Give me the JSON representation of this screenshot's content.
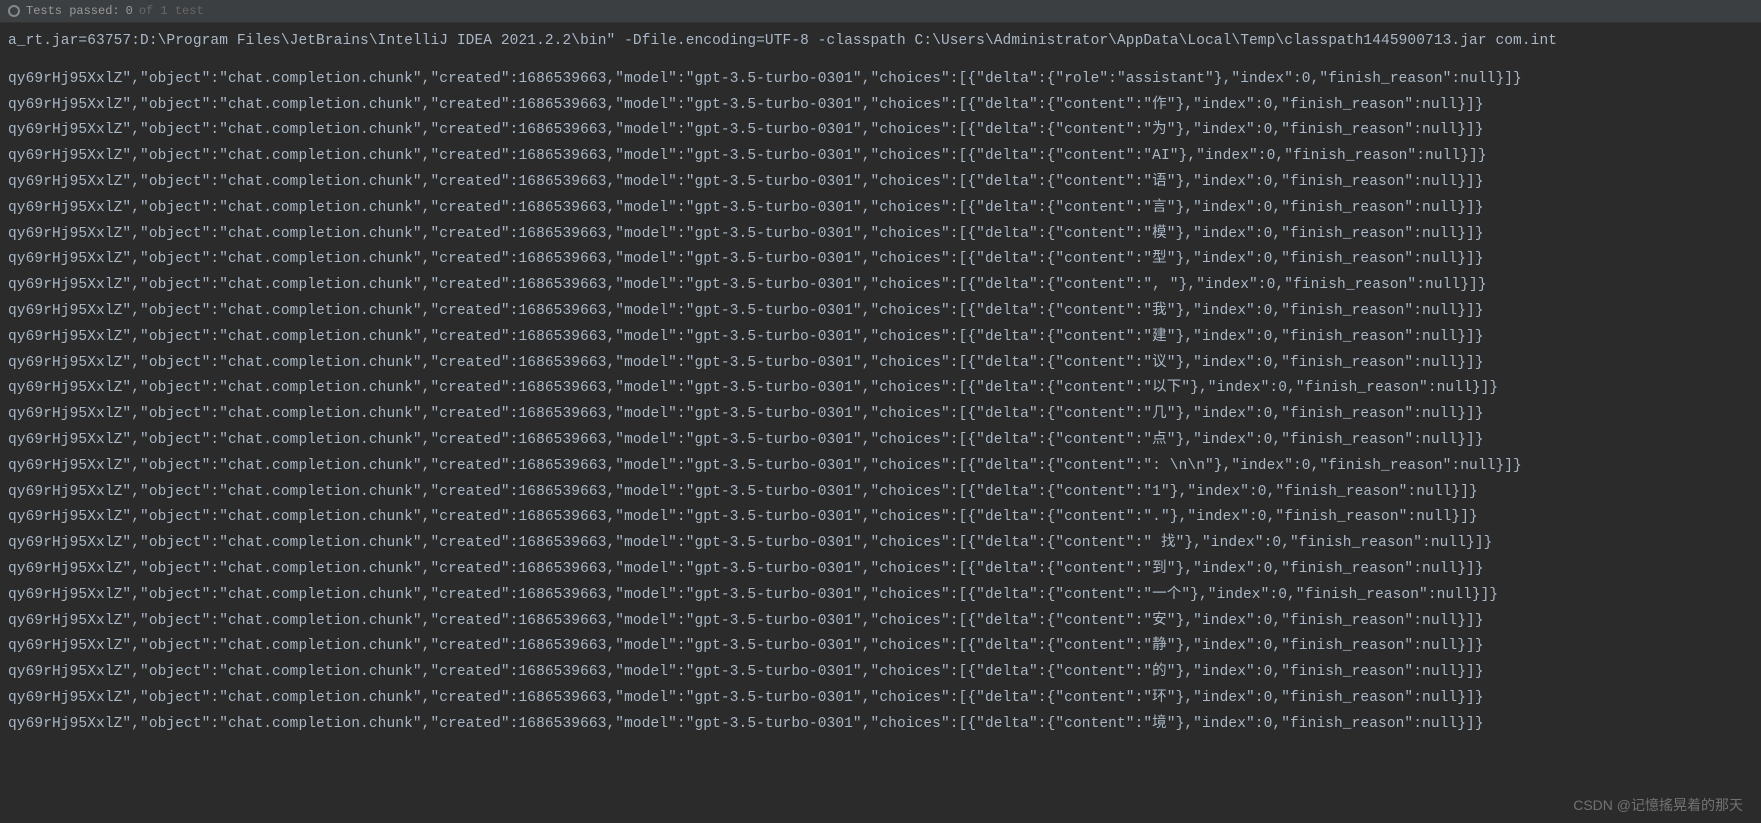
{
  "tests_bar": {
    "prefix": "Tests passed:",
    "count": "0",
    "suffix": "of 1 test"
  },
  "command_line": "a_rt.jar=63757:D:\\Program Files\\JetBrains\\IntelliJ IDEA 2021.2.2\\bin\" -Dfile.encoding=UTF-8 -classpath C:\\Users\\Administrator\\AppData\\Local\\Temp\\classpath1445900713.jar com.int",
  "log_common": {
    "id_prefix": "qy69rHj95XxlZ",
    "object": "chat.completion.chunk",
    "created": 1686539663,
    "model": "gpt-3.5-turbo-0301",
    "index": 0,
    "finish_reason": "null"
  },
  "log_deltas": [
    {
      "role": "assistant"
    },
    {
      "content": "作"
    },
    {
      "content": "为"
    },
    {
      "content": "AI"
    },
    {
      "content": "语"
    },
    {
      "content": "言"
    },
    {
      "content": "模"
    },
    {
      "content": "型"
    },
    {
      "content": ", "
    },
    {
      "content": "我"
    },
    {
      "content": "建"
    },
    {
      "content": "议"
    },
    {
      "content": "以下"
    },
    {
      "content": "几"
    },
    {
      "content": "点"
    },
    {
      "content": ": \\n\\n"
    },
    {
      "content": "1"
    },
    {
      "content": "."
    },
    {
      "content": " 找"
    },
    {
      "content": "到"
    },
    {
      "content": "一个"
    },
    {
      "content": "安"
    },
    {
      "content": "静"
    },
    {
      "content": "的"
    },
    {
      "content": "环"
    },
    {
      "content": "境"
    }
  ],
  "watermark": "CSDN @记憶搖晃着的那天"
}
